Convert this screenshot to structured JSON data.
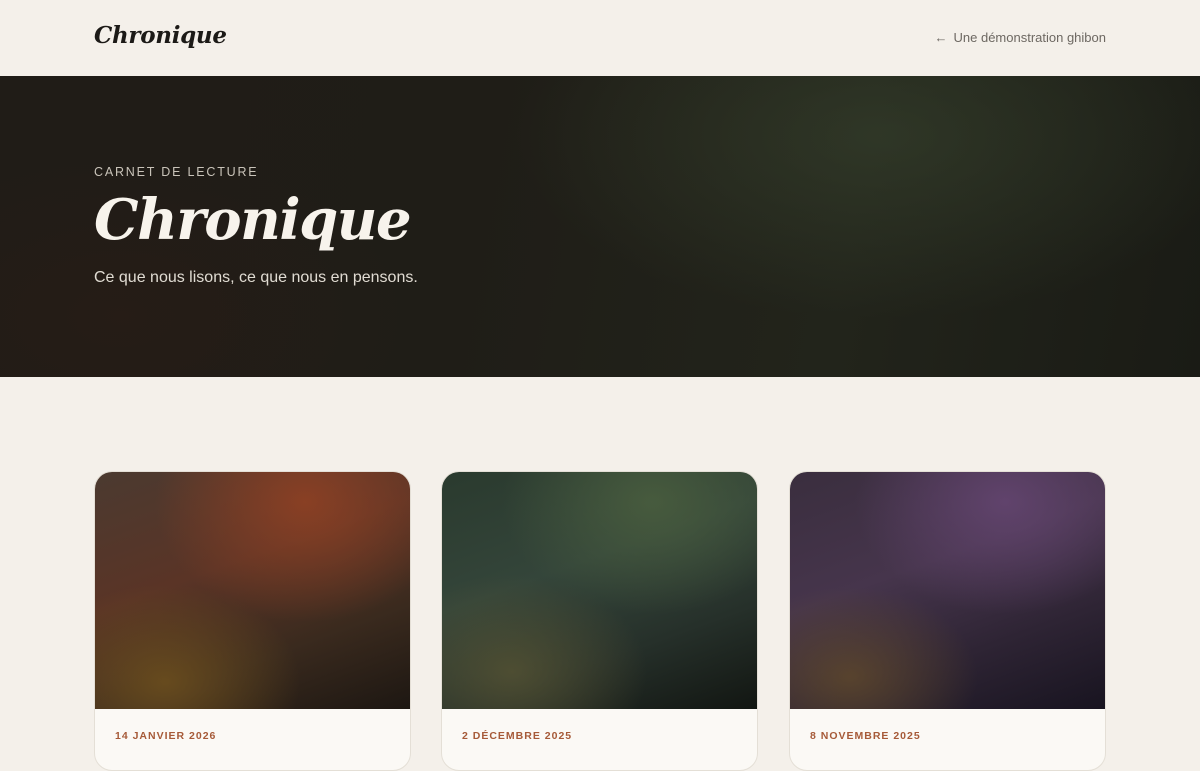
{
  "header": {
    "brand": "Chronique",
    "back_link": "Une démonstration ghibon"
  },
  "hero": {
    "eyebrow": "CARNET DE LECTURE",
    "title": "Chronique",
    "subtitle": "Ce que nous lisons, ce que nous en pensons."
  },
  "cards": [
    {
      "date": "14 JANVIER 2026"
    },
    {
      "date": "2 DÉCEMBRE 2025"
    },
    {
      "date": "8 NOVEMBRE 2025"
    }
  ],
  "colors": {
    "background": "#f4f0ea",
    "hero_dark": "#1f1d17",
    "accent_date": "#a65a38",
    "text_dark": "#1c1a17"
  }
}
